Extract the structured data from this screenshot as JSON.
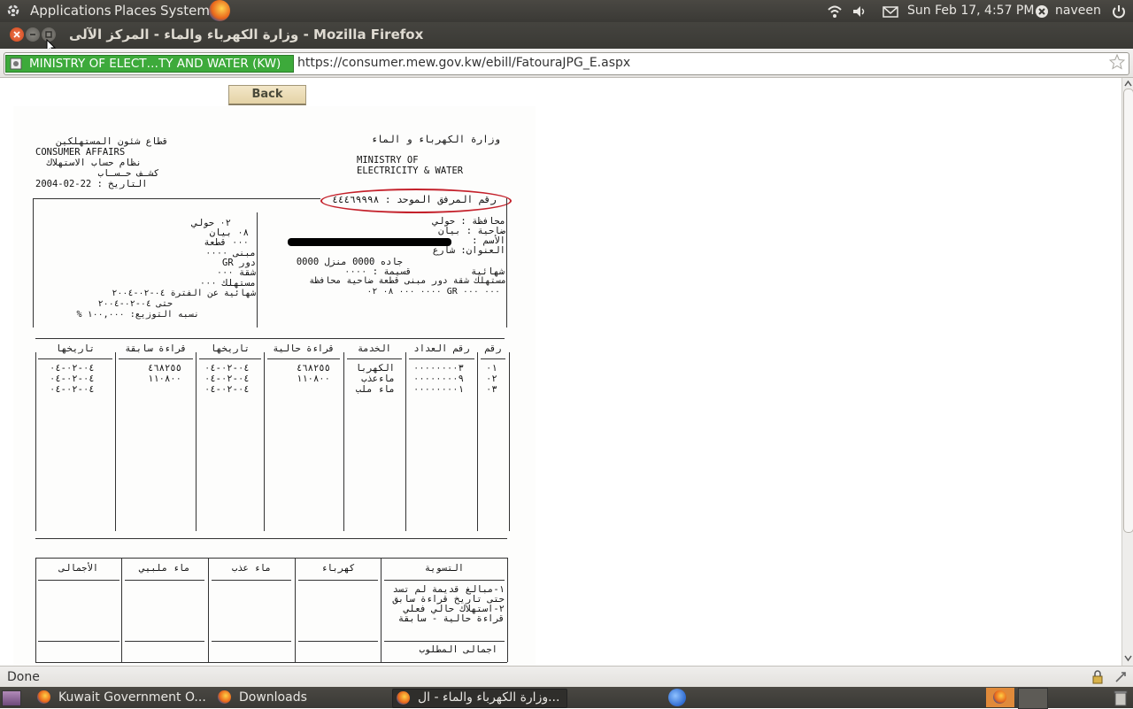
{
  "top_panel": {
    "menus": [
      "Applications",
      "Places",
      "System"
    ],
    "clock": "Sun Feb 17,  4:57 PM",
    "user": "naveen",
    "icons": [
      "gnome-foot-icon",
      "firefox-launcher-icon",
      "wifi-icon",
      "volume-icon",
      "mail-icon",
      "user-icon",
      "power-icon"
    ]
  },
  "window": {
    "title": "وزارة الكهرباء والماء - المركز الآلى - Mozilla Firefox"
  },
  "navbar": {
    "site_identity": "MINISTRY OF ELECT…TY AND WATER (KW)",
    "url": "https://consumer.mew.gov.kw/ebill/FatouraJPG_E.aspx"
  },
  "page": {
    "back_label": "Back"
  },
  "bill": {
    "header_right_ar": [
      "وزارة الكهرباء و الماء"
    ],
    "header_right_en": [
      "MINISTRY OF",
      "ELECTRICITY & WATER"
    ],
    "header_left": [
      "قطاع شئون المستهلكين",
      "CONSUMER AFFAIRS",
      "نظام حساب الاستهلاك",
      "كشـف حـسـاب",
      "التاريخ : 22-02-2004"
    ],
    "unified_no": "رقم المرفق الموحد : ٤٤٤٦٩٩٩٨",
    "right_block": [
      "محافظة : حولي",
      "ضاحية : بيان",
      "الأسم :",
      "العنوان: شارع",
      "جاده 0000 منزل 0000",
      "قسيمة : ٠٠٠٠",
      "شهائية",
      "مستهلك   شقة    دور  مبنى قطعة  ضاحية محافظة",
      "٠٠٠     ٠٠٠    GR    ٠٠٠٠  ٠٠٠   ٠٨   ٠٢"
    ],
    "left_block": [
      "٠٢ حولي",
      "٠٨ بيان",
      "٠٠٠ قطعة",
      "مبنى  ٠٠٠٠",
      "دور    GR",
      "شقة    ٠٠٠",
      "مستهلك  ٠٠٠",
      "شهائية  عن الفترة  ٠٤-٠٢-٢٠٠٤",
      "حتى  ٠٤-٠٢-٢٠٠٤",
      "نسبه التوزيع: ١٠٠,٠٠٠ %"
    ],
    "readings": {
      "headers": [
        "رقم",
        "رقم العداد",
        "الخدمة",
        "قراءة حالية",
        "تاريخها",
        "قراءة سابقة",
        "تاريخها"
      ],
      "rows": [
        [
          "٠١",
          "٠٠٠٠٠٠٠٠٣",
          "الكهربا",
          "٤٦٨٢٥٥",
          "٠٤-٠٢-٠٤",
          "٤٦٨٢٥٥",
          "٠٤-٠٢-٠٤"
        ],
        [
          "٠٢",
          "٠٠٠٠٠٠٠٠٩",
          "ماءعذب",
          "١١٠٨٠٠",
          "٠٤-٠٢-٠٤",
          "١١٠٨٠٠",
          "٠٤-٠٢-٠٤"
        ],
        [
          "٠٣",
          "٠٠٠٠٠٠٠٠١",
          "ماء ملب",
          "",
          "٠٤-٠٢-٠٤",
          "",
          "٠٤-٠٢-٠٤"
        ]
      ]
    },
    "settlement": {
      "headers": [
        "التسوية",
        "كهرباء",
        "ماء عذب",
        "ماء ملبيي",
        "الأجمالى"
      ],
      "items": [
        "١-مبالغ قديمة لم تسد",
        "حتى تاريخ قراءة سابق",
        "٢-استهلاك حالي فعلي",
        "قراءة حالية - سابقة"
      ],
      "total_label": "اجمالى   المطلوب"
    }
  },
  "status": {
    "text": "Done"
  },
  "taskbar": {
    "items": [
      {
        "label": "Kuwait Government O..."
      },
      {
        "label": "Downloads"
      },
      {
        "label": "وزارة الكهرباء والماء - ال..."
      }
    ]
  }
}
